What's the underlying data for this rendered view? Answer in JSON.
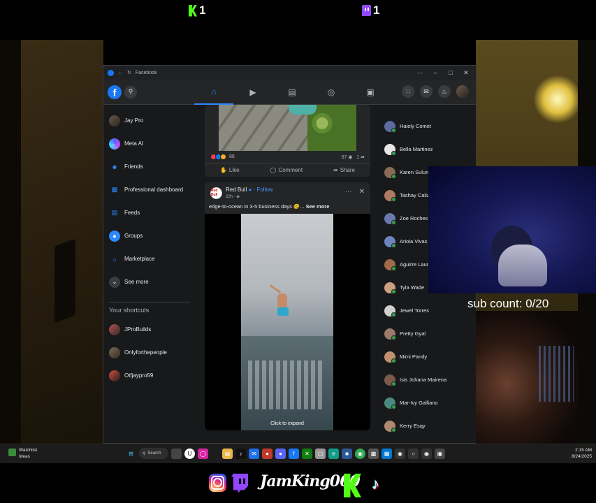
{
  "overlay": {
    "kick_count": "1",
    "twitch_count": "1",
    "sub_count_label": "sub count:",
    "sub_count_value": "0/20",
    "handle": "JamKing060"
  },
  "browser": {
    "tab_title": "Facebook",
    "controls": [
      "⋯",
      "–",
      "□",
      "✕"
    ]
  },
  "fb": {
    "logo_letter": "f",
    "nav_tabs": [
      {
        "icon": "home-icon",
        "glyph": "⌂"
      },
      {
        "icon": "video-icon",
        "glyph": "▶"
      },
      {
        "icon": "marketplace-icon",
        "glyph": "▤"
      },
      {
        "icon": "groups-icon",
        "glyph": "◎"
      },
      {
        "icon": "gaming-icon",
        "glyph": "▣"
      }
    ],
    "sidebar": {
      "items": [
        {
          "label": "Jay Pro"
        },
        {
          "label": "Meta AI"
        },
        {
          "label": "Friends"
        },
        {
          "label": "Professional dashboard"
        },
        {
          "label": "Feeds"
        },
        {
          "label": "Groups"
        },
        {
          "label": "Marketplace"
        },
        {
          "label": "See more"
        }
      ],
      "shortcuts_heading": "Your shortcuts",
      "shortcuts": [
        {
          "label": "JProBuilds"
        },
        {
          "label": "Onlyforthepeople"
        },
        {
          "label": "Otfjaypro59"
        }
      ]
    },
    "post1": {
      "reactions_count": "88",
      "comments_count": "67",
      "shares_count": "1",
      "like_label": "Like",
      "comment_label": "Comment",
      "share_label": "Share"
    },
    "post2": {
      "author": "Red Bull",
      "follow": "· Follow",
      "time": "22h ·",
      "text": "edge-to-ocean in 3-5 business days 🫨...",
      "see_more": "See more",
      "expand_label": "Click to expand",
      "logo_text": "Red Bull"
    },
    "contacts": [
      "Haiely Comet",
      "Bella Martinez",
      "Karen Sulun",
      "Tashay Caliz",
      "Zoe Roches",
      "Ariola Vivas",
      "Aguirre Laur",
      "Tyla Wade",
      "Jewel Torres",
      "Pretty Gyal",
      "Mimi Pandy",
      "Isis Johana Mairena",
      "Mar-Ivy Galliano",
      "Kerry Esqy"
    ]
  },
  "taskbar": {
    "widget_title": "Watchlist",
    "widget_sub": "Ideas",
    "search_label": "Search",
    "time": "2:15 AM",
    "date": "8/24/2025"
  }
}
